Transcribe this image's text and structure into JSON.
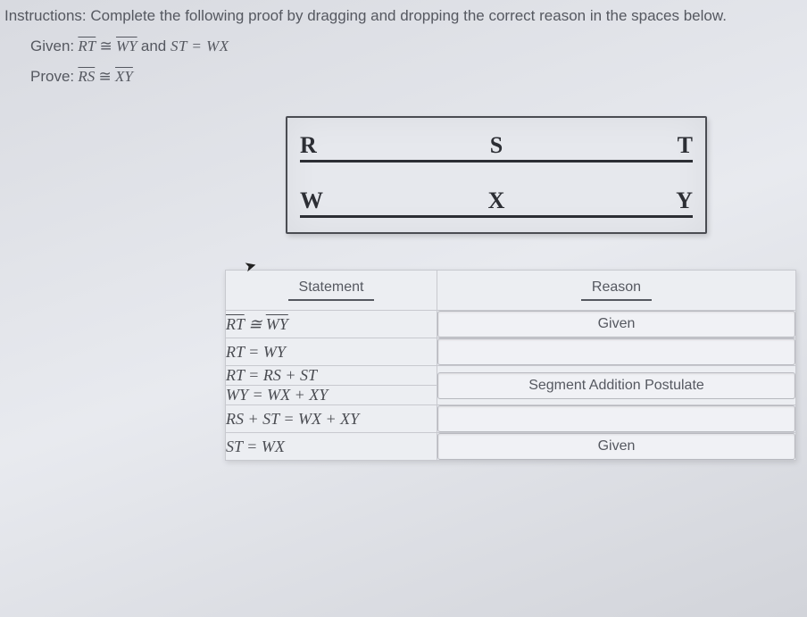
{
  "instructions": "Instructions: Complete the following proof by dragging and dropping the correct reason in the spaces below.",
  "given": {
    "label": "Given:",
    "seg1a": "RT",
    "cong": "≅",
    "seg1b": "WY",
    "and": " and ",
    "eq": "ST = WX"
  },
  "prove": {
    "label": "Prove:",
    "segA": "RS",
    "cong": "≅",
    "segB": "XY"
  },
  "diagram": {
    "line1": {
      "l": "R",
      "m": "S",
      "r": "T"
    },
    "line2": {
      "l": "W",
      "m": "X",
      "r": "Y"
    }
  },
  "table": {
    "headStatement": "Statement",
    "headReason": "Reason",
    "rows": [
      {
        "stmt_seg1": "RT",
        "stmt_mid": " ≅ ",
        "stmt_seg2": "WY",
        "reason": "Given"
      },
      {
        "stmt_plain": "RT = WY",
        "reason": ""
      },
      {
        "stmt_plain": "RT = RS + ST",
        "reason_hidden": true
      },
      {
        "stmt_plain": "WY = WX + XY",
        "reason": "Segment Addition Postulate"
      },
      {
        "stmt_plain": "RS + ST = WX + XY",
        "reason": ""
      },
      {
        "stmt_plain": "ST = WX",
        "reason": "Given"
      }
    ]
  }
}
